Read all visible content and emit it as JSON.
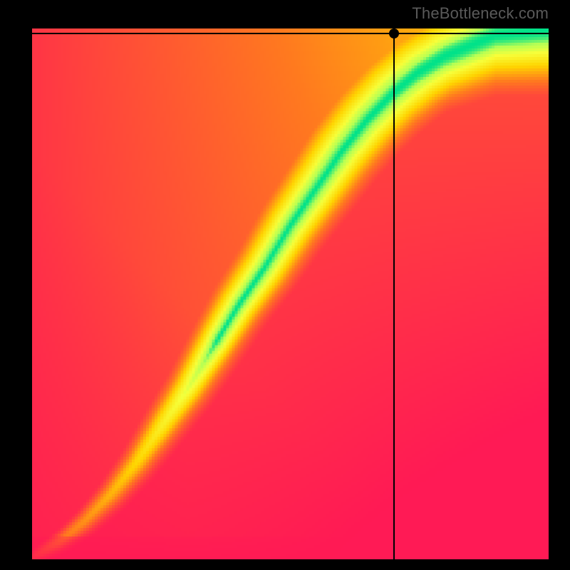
{
  "watermark": "TheBottleneck.com",
  "chart_data": {
    "type": "heatmap",
    "title": "",
    "xlabel": "",
    "ylabel": "",
    "xlim": [
      0,
      100
    ],
    "ylim": [
      0,
      100
    ],
    "colorscale": [
      {
        "t": 0.0,
        "color": "#ff1a55"
      },
      {
        "t": 0.35,
        "color": "#ff7a1f"
      },
      {
        "t": 0.6,
        "color": "#ffd400"
      },
      {
        "t": 0.82,
        "color": "#f7ff3a"
      },
      {
        "t": 0.93,
        "color": "#b6ff55"
      },
      {
        "t": 1.0,
        "color": "#00e28a"
      }
    ],
    "ideal_curve": {
      "description": "green optimal ridge mapping x (CPU score) to y (GPU score)",
      "points": [
        {
          "x": 0,
          "y": 0
        },
        {
          "x": 5,
          "y": 3
        },
        {
          "x": 10,
          "y": 7
        },
        {
          "x": 15,
          "y": 12
        },
        {
          "x": 20,
          "y": 18
        },
        {
          "x": 25,
          "y": 25
        },
        {
          "x": 30,
          "y": 32
        },
        {
          "x": 35,
          "y": 40
        },
        {
          "x": 40,
          "y": 48
        },
        {
          "x": 45,
          "y": 55
        },
        {
          "x": 50,
          "y": 63
        },
        {
          "x": 55,
          "y": 70
        },
        {
          "x": 60,
          "y": 77
        },
        {
          "x": 65,
          "y": 83
        },
        {
          "x": 70,
          "y": 88
        },
        {
          "x": 75,
          "y": 92
        },
        {
          "x": 80,
          "y": 95
        },
        {
          "x": 85,
          "y": 97
        },
        {
          "x": 90,
          "y": 99
        },
        {
          "x": 100,
          "y": 100
        }
      ],
      "band_width_frac": 0.055,
      "band_min_frac": 0.008
    },
    "marker": {
      "x": 70,
      "y": 99
    },
    "crosshair": {
      "x": 70,
      "y": 99
    },
    "corner_scores": {
      "top_left": 0.35,
      "top_right": 0.62,
      "bottom_left": 0.0,
      "bottom_right": 0.0
    }
  }
}
